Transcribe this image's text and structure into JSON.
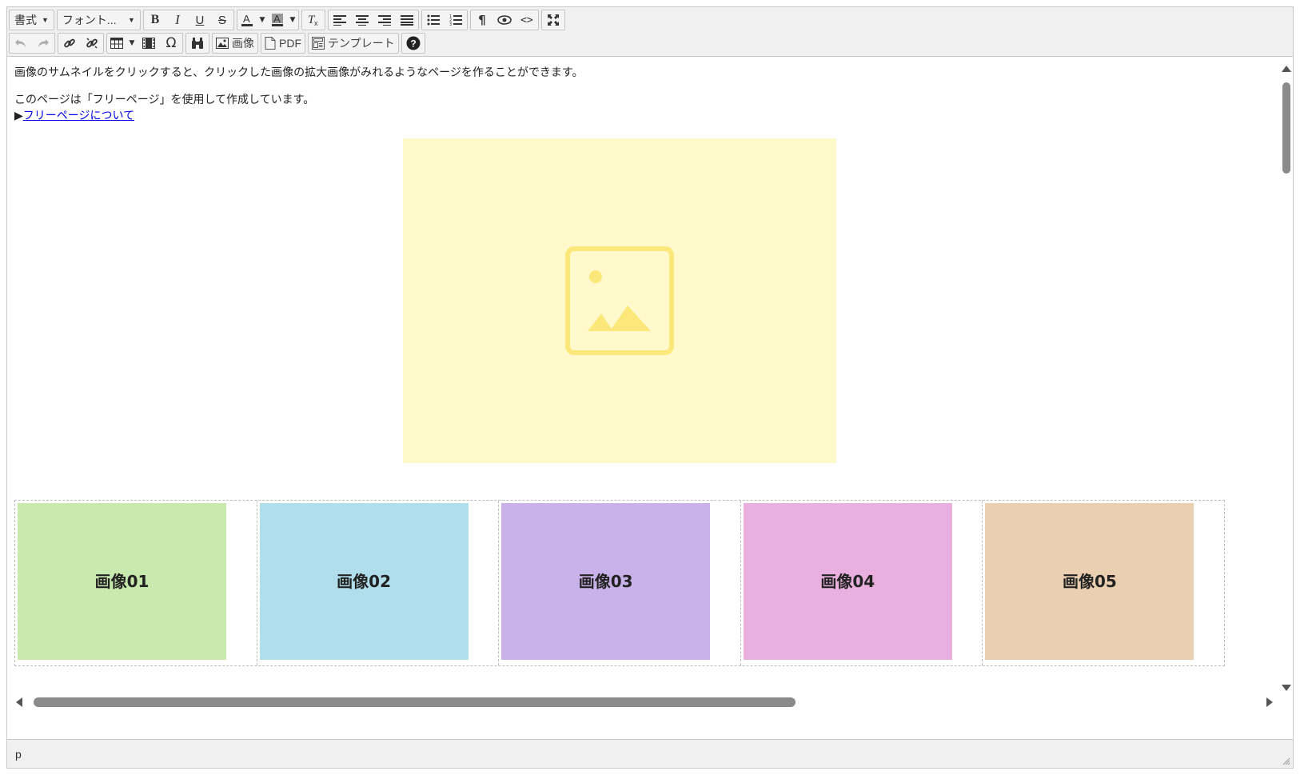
{
  "toolbar": {
    "format_label": "書式",
    "font_label": "フォント...",
    "image_label": "画像",
    "pdf_label": "PDF",
    "template_label": "テンプレート"
  },
  "content": {
    "line1": "画像のサムネイルをクリックすると、クリックした画像の拡大画像がみれるようなページを作ることができます。",
    "line2": "このページは「フリーページ」を使用して作成しています。",
    "link_prefix": "▶",
    "link_text": "フリーページについて",
    "hero_color": "#fff9cc",
    "hero_icon_color": "#fbe77a"
  },
  "gallery": [
    {
      "label": "画像01",
      "color": "#c9eaae"
    },
    {
      "label": "画像02",
      "color": "#b0dfeb"
    },
    {
      "label": "画像03",
      "color": "#c9b2e9"
    },
    {
      "label": "画像04",
      "color": "#e9b0df"
    },
    {
      "label": "画像05",
      "color": "#eacfb0"
    }
  ],
  "statusbar": {
    "path": "p"
  }
}
